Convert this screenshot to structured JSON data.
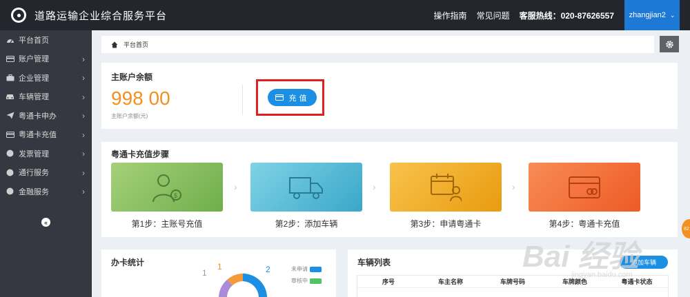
{
  "app": {
    "title": "道路运输企业综合服务平台"
  },
  "header": {
    "links": [
      "操作指南",
      "常见问题"
    ],
    "hotline": "客服热线：020-87626557",
    "username": "zhangjian2"
  },
  "sidebar": {
    "items": [
      {
        "label": "平台首页",
        "icon": "dashboard-icon",
        "has_arrow": false
      },
      {
        "label": "账户管理",
        "icon": "card-icon",
        "has_arrow": true
      },
      {
        "label": "企业管理",
        "icon": "briefcase-icon",
        "has_arrow": true
      },
      {
        "label": "车辆管理",
        "icon": "car-icon",
        "has_arrow": true
      },
      {
        "label": "粤通卡申办",
        "icon": "send-icon",
        "has_arrow": true
      },
      {
        "label": "粤通卡充值",
        "icon": "card-icon",
        "has_arrow": true
      },
      {
        "label": "发票管理",
        "icon": "circle-icon",
        "has_arrow": true
      },
      {
        "label": "通行服务",
        "icon": "circle-icon",
        "has_arrow": true
      },
      {
        "label": "金融服务",
        "icon": "circle-icon",
        "has_arrow": true
      }
    ],
    "collapse": "«"
  },
  "breadcrumb": {
    "label": "平台首页"
  },
  "balance": {
    "title": "主账户余额",
    "value": "998 00",
    "label": "主账户余额(元)",
    "button": "充值"
  },
  "steps": {
    "title": "粤通卡充值步骤",
    "items": [
      {
        "label": "第1步：主账号充值",
        "color": "#7cb454",
        "icon": "person-money-icon"
      },
      {
        "label": "第2步：添加车辆",
        "color": "#45b2d1",
        "icon": "truck-icon"
      },
      {
        "label": "第3步：申请粤通卡",
        "color": "#f0a520",
        "icon": "calendar-person-icon"
      },
      {
        "label": "第4步：粤通卡充值",
        "color": "#f2622e",
        "icon": "bank-card-icon"
      }
    ]
  },
  "stats": {
    "title": "办卡统计",
    "donut_labels": [
      "1",
      "1",
      "2"
    ],
    "legend": [
      {
        "label": "未申请",
        "color": "#1a8fe3"
      },
      {
        "label": "审核中",
        "color": "#52c463"
      }
    ]
  },
  "vehicles": {
    "title": "车辆列表",
    "add_button": "添加车辆",
    "columns": [
      "序号",
      "车主名称",
      "车牌号码",
      "车牌颜色",
      "粤通卡状态"
    ]
  },
  "float_badge": "82",
  "watermark": {
    "text": "Bai 经验",
    "sub": "jingyan.baidu.com"
  }
}
